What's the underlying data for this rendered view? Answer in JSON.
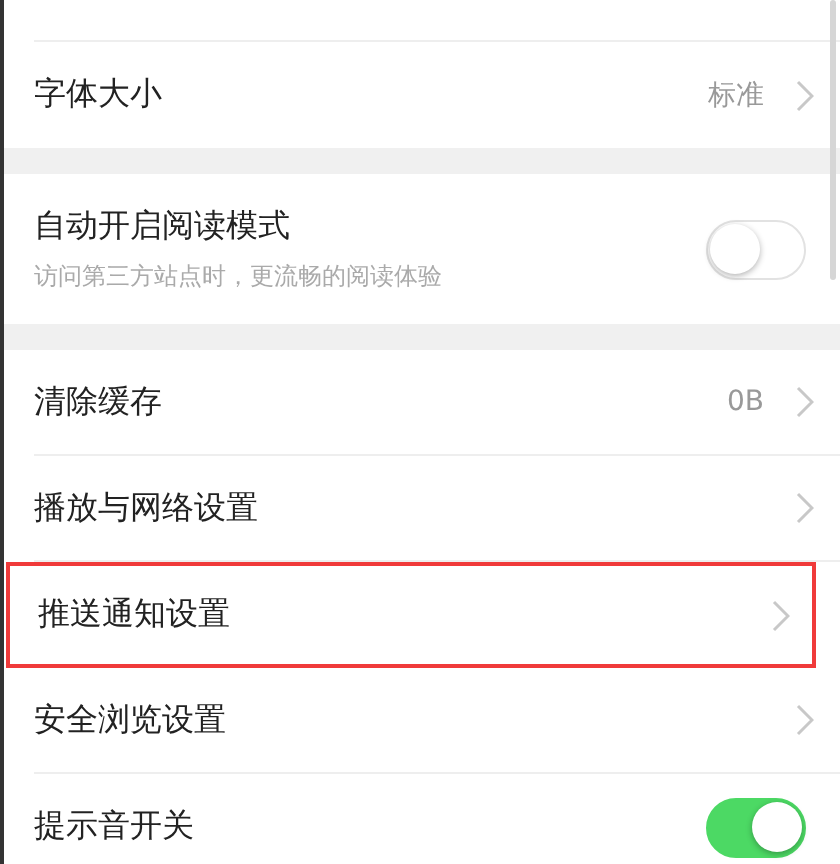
{
  "sections": [
    {
      "items": [
        {
          "kind": "nav",
          "label": "字体大小",
          "value": "标准",
          "annotated": false
        }
      ]
    },
    {
      "items": [
        {
          "kind": "toggle",
          "label": "自动开启阅读模式",
          "subtitle": "访问第三方站点时，更流畅的阅读体验",
          "on": false,
          "annotated": false
        }
      ]
    },
    {
      "items": [
        {
          "kind": "nav",
          "label": "清除缓存",
          "value": "0B",
          "annotated": false
        },
        {
          "kind": "nav",
          "label": "播放与网络设置",
          "annotated": false
        },
        {
          "kind": "nav",
          "label": "推送通知设置",
          "annotated": true
        },
        {
          "kind": "nav",
          "label": "安全浏览设置",
          "annotated": false
        },
        {
          "kind": "toggle",
          "label": "提示音开关",
          "on": true,
          "annotated": false
        }
      ]
    }
  ]
}
